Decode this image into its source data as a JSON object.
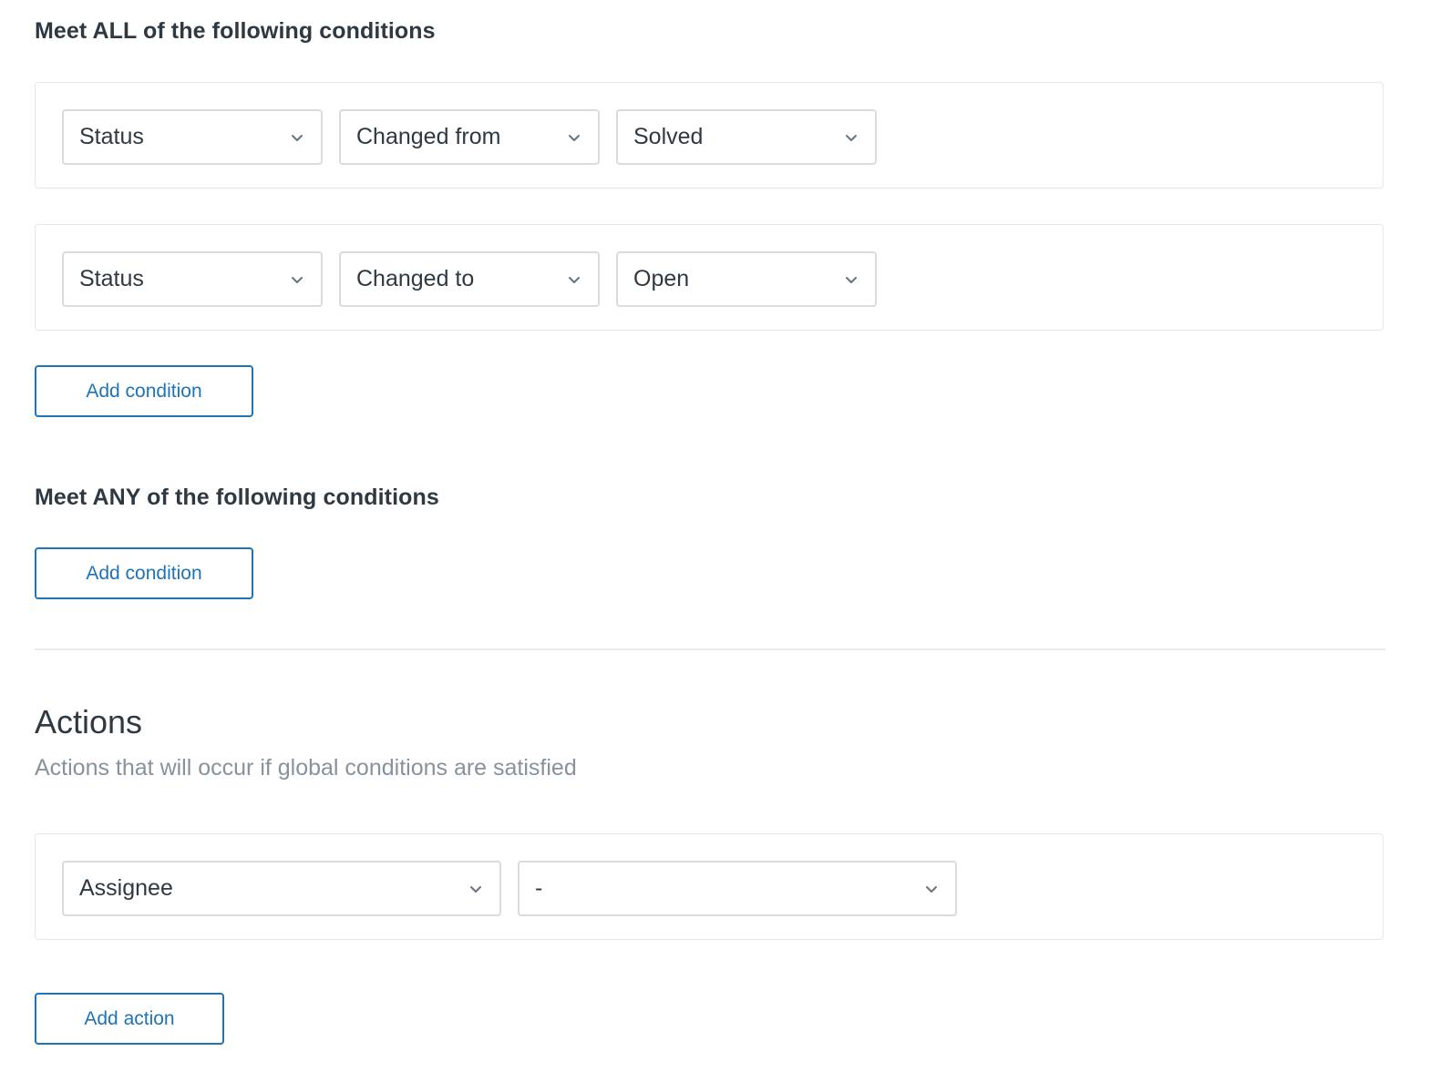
{
  "all_section": {
    "heading": "Meet ALL of the following conditions",
    "conditions": [
      {
        "field": "Status",
        "operator": "Changed from",
        "value": "Solved"
      },
      {
        "field": "Status",
        "operator": "Changed to",
        "value": "Open"
      }
    ],
    "add_label": "Add condition"
  },
  "any_section": {
    "heading": "Meet ANY of the following conditions",
    "add_label": "Add condition"
  },
  "actions": {
    "title": "Actions",
    "subtitle": "Actions that will occur if global conditions are satisfied",
    "rows": [
      {
        "field": "Assignee",
        "value": "-"
      }
    ],
    "add_label": "Add action"
  },
  "colors": {
    "accent": "#1f73b7",
    "text": "#2f3941",
    "muted": "#87929d",
    "border": "#d8dcde"
  }
}
